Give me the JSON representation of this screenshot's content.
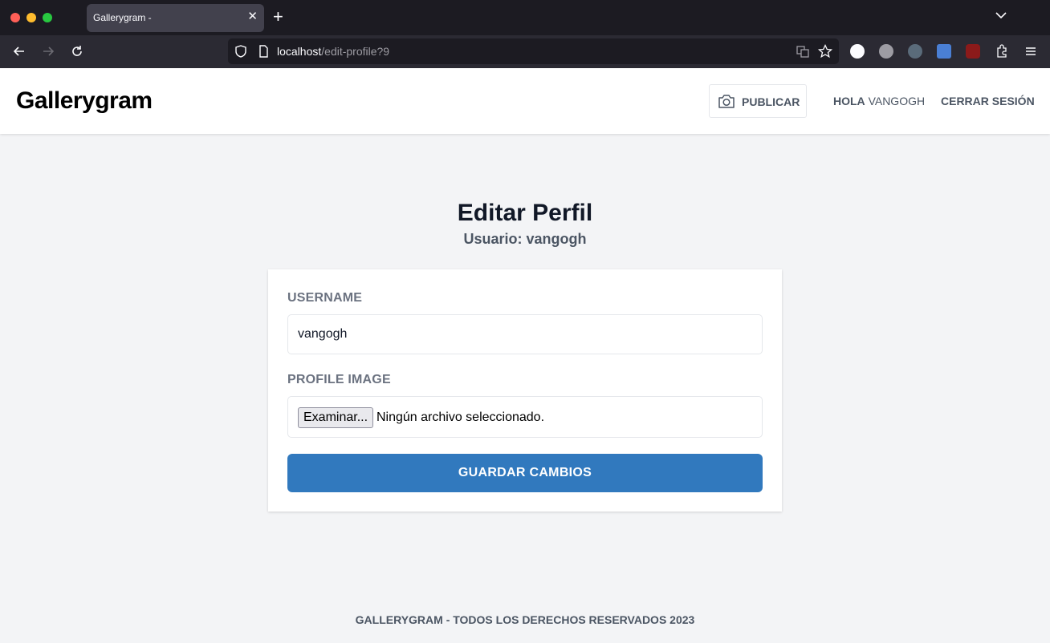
{
  "browser": {
    "tab_title": "Gallerygram -",
    "tab_close": "✕",
    "new_tab": "+",
    "url_host": "localhost",
    "url_path": "/edit-profile?9"
  },
  "header": {
    "brand": "Gallerygram",
    "publish_label": "PUBLICAR",
    "greeting_prefix": "HOLA",
    "greeting_user": "VANGOGH",
    "logout_label": "CERRAR SESIÓN"
  },
  "main": {
    "title": "Editar Perfil",
    "subtitle": "Usuario: vangogh"
  },
  "form": {
    "username_label": "USERNAME",
    "username_value": "vangogh",
    "profile_image_label": "PROFILE IMAGE",
    "file_button": "Examinar...",
    "file_status": "Ningún archivo seleccionado.",
    "submit_label": "GUARDAR CAMBIOS"
  },
  "footer": {
    "text": "GALLERYGRAM - TODOS LOS DERECHOS RESERVADOS 2023"
  },
  "colors": {
    "primary_button": "#3179be",
    "page_bg": "#f3f4f6",
    "chrome_dark": "#1c1b22"
  }
}
